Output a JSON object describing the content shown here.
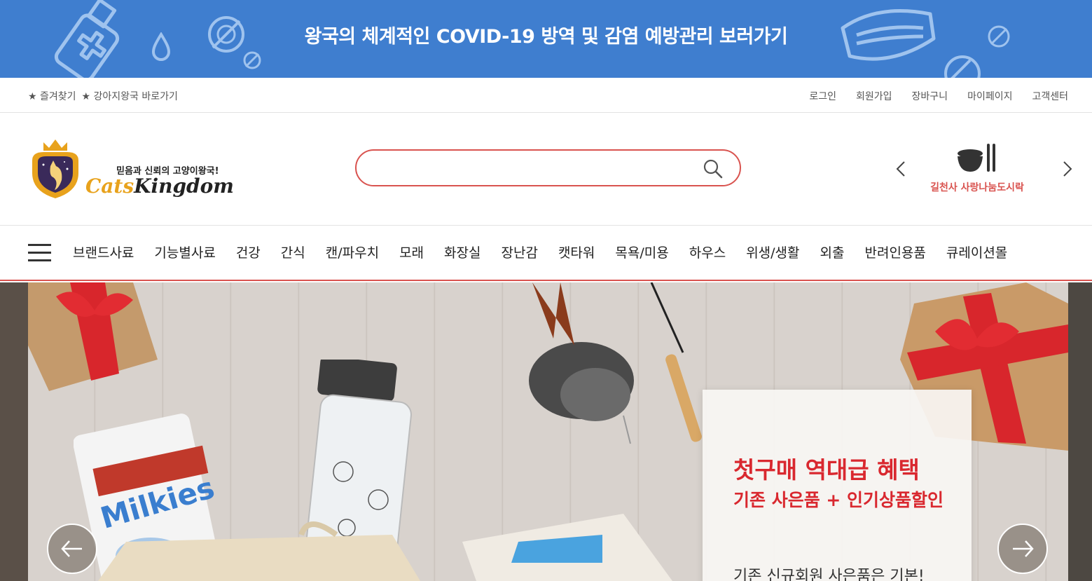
{
  "covid_banner": {
    "text": "왕국의 체계적인 COVID-19 방역 및 감염 예방관리 보러가기"
  },
  "util_bar": {
    "left": [
      "★ 즐겨찾기",
      "★ 강아지왕국 바로가기"
    ],
    "right": [
      "로그인",
      "회원가입",
      "장바구니",
      "마이페이지",
      "고객센터"
    ]
  },
  "header": {
    "logo_slogan": "믿음과 신뢰의 고양이왕국!",
    "logo_cats": "Cats",
    "logo_kingdom": "Kingdom",
    "search_placeholder": "",
    "promo_label": "길천사 사랑나눔도시락"
  },
  "categories": [
    "브랜드사료",
    "기능별사료",
    "건강",
    "간식",
    "캔/파우치",
    "모래",
    "화장실",
    "장난감",
    "캣타워",
    "목욕/미용",
    "하우스",
    "위생/생활",
    "외출",
    "반려인용품",
    "큐레이션몰"
  ],
  "hero": {
    "headline": "첫구매 역대급 혜택",
    "subline": "기존 사은품 + 인기상품할인",
    "foot": "기존 신규회원 사은품은 기본!"
  },
  "colors": {
    "banner_bg": "#3f7ecf",
    "accent": "#d9534f",
    "hero_text": "#d9282f"
  },
  "icons": {
    "search": "search-icon",
    "prev": "chevron-left-icon",
    "next": "chevron-right-icon",
    "menu": "hamburger-icon",
    "lunchbox": "lunchbox-icon"
  }
}
